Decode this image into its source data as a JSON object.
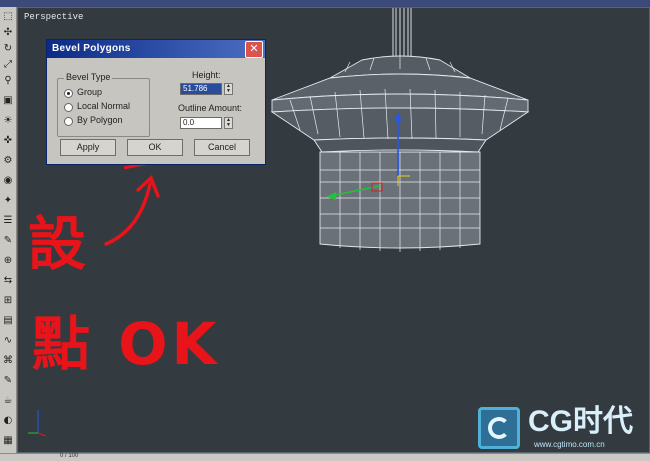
{
  "viewport": {
    "label": "Perspective"
  },
  "dialog": {
    "title": "Bevel Polygons",
    "close_glyph": "✕",
    "bevel_type": {
      "legend": "Bevel Type",
      "options": [
        "Group",
        "Local Normal",
        "By Polygon"
      ],
      "selected": "Group"
    },
    "height": {
      "label": "Height:",
      "value": "51.786"
    },
    "outline_amount": {
      "label": "Outline Amount:",
      "value": "0.0"
    },
    "buttons": {
      "apply": "Apply",
      "ok": "OK",
      "cancel": "Cancel"
    }
  },
  "annotations": {
    "set": "設",
    "click_ok": "點 OK"
  },
  "watermark": {
    "brand": "CG时代",
    "url": "www.cgtimo.com.cn"
  },
  "status": {
    "value": "0 / 100"
  },
  "colors": {
    "annotation": "#e8141a",
    "title_bar": "#0c2b86",
    "viewport_bg": "#333a40",
    "logo": "#4fb1d8"
  },
  "icons": [
    "select-icon",
    "move-icon",
    "rotate-icon",
    "scale-icon",
    "link-icon",
    "camera-icon",
    "light-icon",
    "helper-icon",
    "modifier-icon",
    "material-icon",
    "render-icon",
    "hierarchy-icon"
  ]
}
